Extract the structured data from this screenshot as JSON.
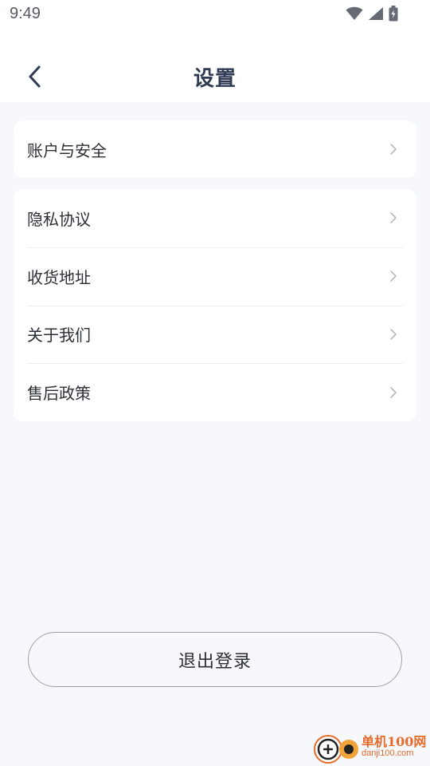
{
  "status_bar": {
    "time": "9:49",
    "icons": [
      "wifi-icon",
      "cell-signal-icon",
      "battery-charging-icon"
    ]
  },
  "header": {
    "back_icon": "chevron-left-icon",
    "title": "设置"
  },
  "account_card": {
    "items": [
      {
        "label": "账户与安全"
      }
    ]
  },
  "info_card": {
    "items": [
      {
        "label": "隐私协议"
      },
      {
        "label": "收货地址"
      },
      {
        "label": "关于我们"
      },
      {
        "label": "售后政策"
      }
    ]
  },
  "logout": {
    "label": "退出登录"
  },
  "watermark": {
    "cn": "单机100网",
    "en": "danji100.com"
  },
  "colors": {
    "background": "#f7f8fc",
    "card": "#ffffff",
    "title": "#2f3a55",
    "text": "#2b2f36",
    "chevron": "#b8bac0",
    "watermark": "#e66b2b"
  }
}
